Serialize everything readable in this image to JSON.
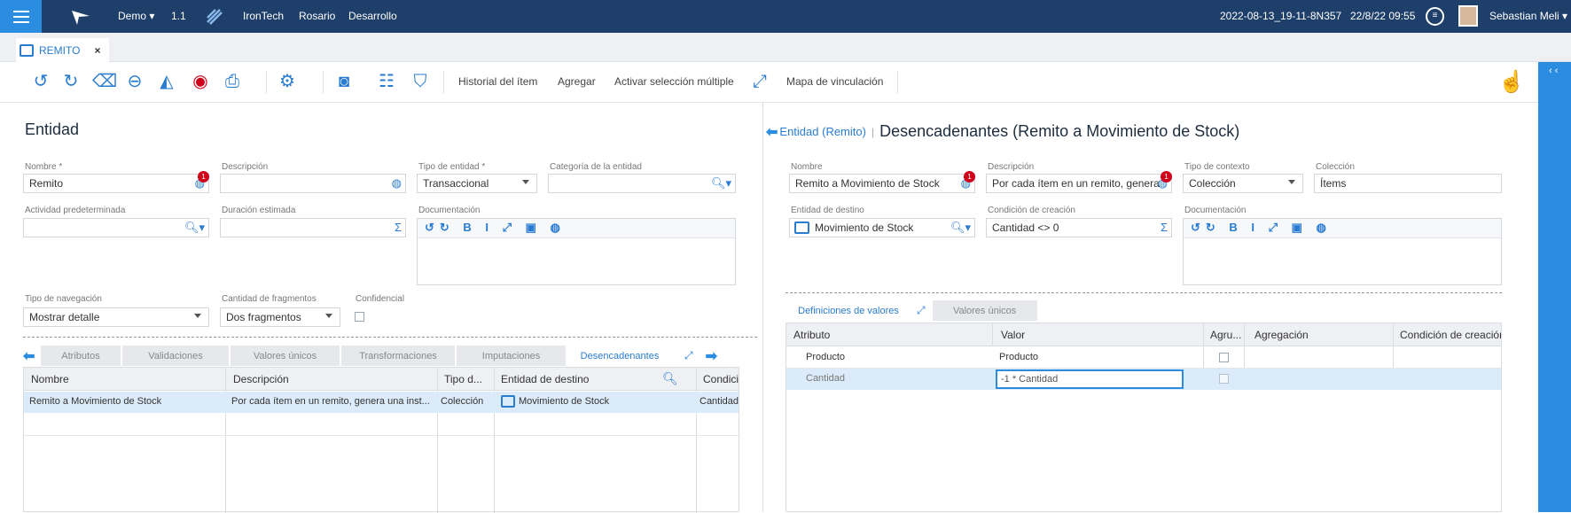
{
  "topbar": {
    "app": "Demo",
    "version": "1.1",
    "company": "IronTech",
    "city": "Rosario",
    "environment": "Desarrollo",
    "build": "2022-08-13_19-11-8N357",
    "datetime": "22/8/22 09:55",
    "user": "Sebastian Meli"
  },
  "tab": {
    "label": "REMITO",
    "close": "×"
  },
  "toolbar": {
    "historial": "Historial del ítem",
    "agregar": "Agregar",
    "activar": "Activar selección múltiple",
    "mapa": "Mapa de vinculación"
  },
  "left": {
    "title": "Entidad",
    "nombre_label": "Nombre *",
    "nombre_value": "Remito",
    "descripcion_label": "Descripción",
    "descripcion_value": "",
    "tipo_entidad_label": "Tipo de entidad *",
    "tipo_entidad_value": "Transaccional",
    "categoria_label": "Categoría de la entidad",
    "categoria_value": "",
    "actividad_label": "Actividad predeterminada",
    "actividad_value": "",
    "duracion_label": "Duración estimada",
    "duracion_value": "",
    "documentacion_label": "Documentación",
    "tipo_nav_label": "Tipo de navegación",
    "tipo_nav_value": "Mostrar detalle",
    "fragmentos_label": "Cantidad de fragmentos",
    "fragmentos_value": "Dos fragmentos",
    "confidencial_label": "Confidencial",
    "badge": "1",
    "tabs": [
      "Atributos",
      "Validaciones",
      "Valores únicos",
      "Transformaciones",
      "Imputaciones",
      "Desencadenantes"
    ],
    "grid_headers": [
      "Nombre",
      "Descripción",
      "Tipo d...",
      "Entidad de destino",
      "Condici"
    ],
    "rows": [
      {
        "nombre": "Remito a Movimiento de Stock",
        "descripcion": "Por cada ítem en un remito, genera una inst...",
        "tipo": "Colección",
        "destino": "Movimiento de Stock",
        "condicion": "Cantidad"
      }
    ]
  },
  "right": {
    "back_link": "Entidad (Remito)",
    "title": "Desencadenantes (Remito a Movimiento de Stock)",
    "nombre_label": "Nombre",
    "nombre_value": "Remito a Movimiento de Stock",
    "descripcion_label": "Descripción",
    "descripcion_value": "Por cada ítem en un remito, genera",
    "tipo_contexto_label": "Tipo de contexto",
    "tipo_contexto_value": "Colección",
    "coleccion_label": "Colección",
    "coleccion_value": "Ítems",
    "destino_label": "Entidad de destino",
    "destino_value": "Movimiento de Stock",
    "condicion_label": "Condición de creación",
    "condicion_value": "Cantidad <> 0",
    "documentacion_label": "Documentación",
    "badge": "1",
    "tabs": [
      "Definiciones de valores",
      "Valores únicos"
    ],
    "grid_headers": [
      "Atributo",
      "Valor",
      "Agru...",
      "Agregación",
      "Condición de creación"
    ],
    "rows": [
      {
        "atributo": "Producto",
        "valor": "Producto"
      },
      {
        "atributo": "Cantidad",
        "valor": "-1 * Cantidad"
      }
    ]
  }
}
